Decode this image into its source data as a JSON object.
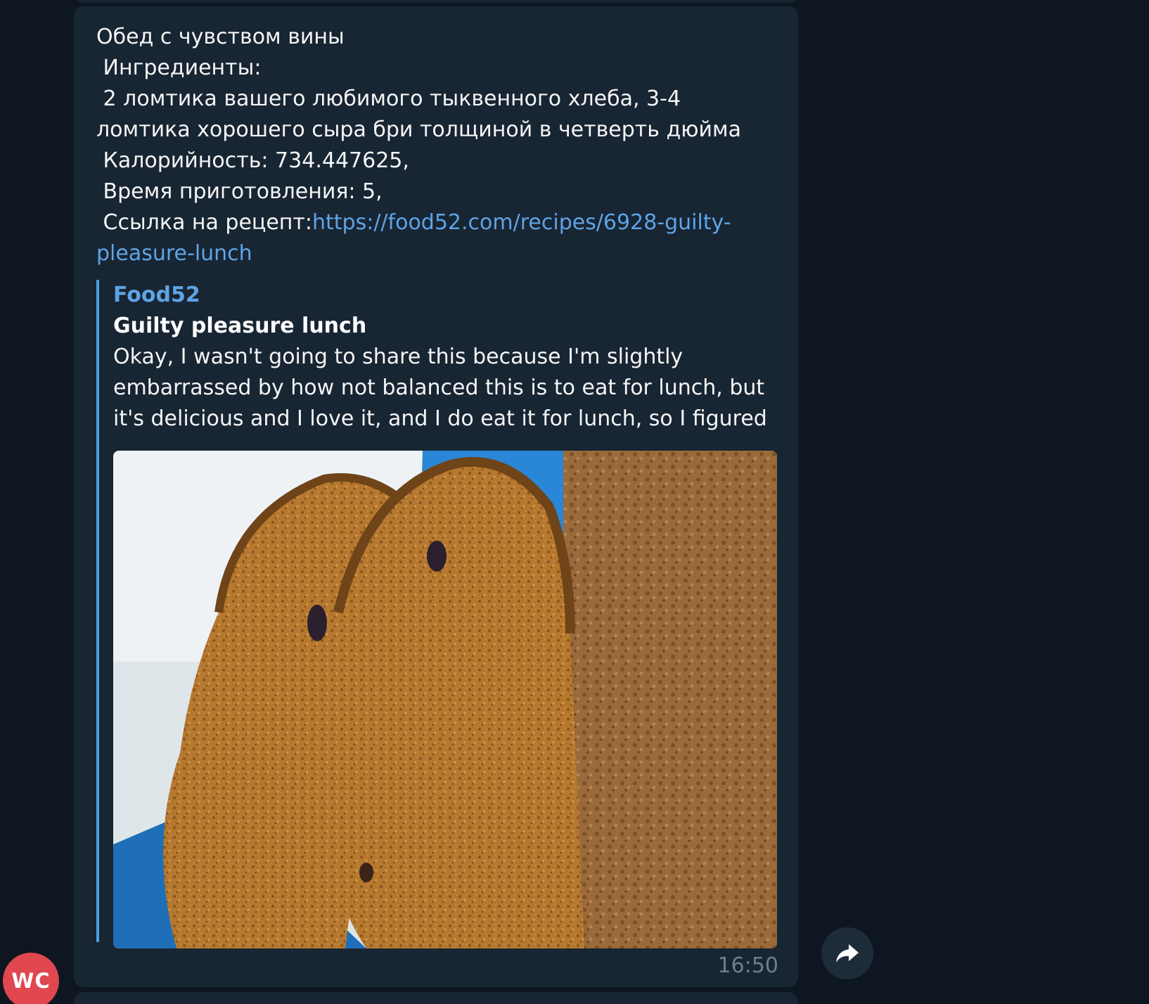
{
  "message": {
    "title": "Обед с чувством вины",
    "ingredients_label": " Ингредиенты:",
    "ingredients": " 2 ломтика вашего любимого тыквенного хлеба, 3-4 ломтика хорошего сыра бри толщиной в четверть дюйма",
    "calories": " Калорийность: 734.447625,",
    "cook_time": " Время приготовления: 5,",
    "link_label": " Ссылка на рецепт:",
    "link_url": "https://food52.com/recipes/6928-guilty-pleasure-lunch",
    "time": "16:50"
  },
  "preview": {
    "site": "Food52",
    "title": "Guilty pleasure lunch",
    "description": "Okay, I wasn't going to share this because I'm slightly embarrassed by how not balanced this is to eat for lunch, but it's delicious and I love it, and I do eat it for lunch, so I figured ...",
    "image_icon": "pumpkin-bread-photo"
  },
  "sender": {
    "initials": "WC",
    "avatar_color": "#e0474f"
  },
  "share_icon": "share-arrow-icon",
  "colors": {
    "background": "#0e1621",
    "bubble": "#182533",
    "link": "#5ea4e6",
    "accent_bar": "#4c9ce2",
    "time": "#6d7f8f"
  }
}
